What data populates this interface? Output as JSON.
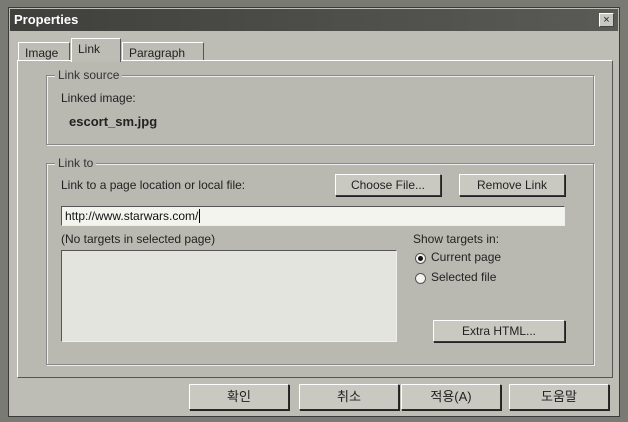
{
  "window": {
    "title": "Properties",
    "close_glyph": "×"
  },
  "tabs": [
    {
      "label": "Image",
      "selected": false
    },
    {
      "label": "Link",
      "selected": true
    },
    {
      "label": "Paragraph",
      "selected": false
    }
  ],
  "link_source": {
    "legend": "Link source",
    "linked_image_label": "Linked image:",
    "linked_image_value": "escort_sm.jpg"
  },
  "link_to": {
    "legend": "Link to",
    "field_label": "Link to a page location or local file:",
    "choose_file_label": "Choose File...",
    "remove_link_label": "Remove Link",
    "url_value": "http://www.starwars.com/",
    "targets_label": "(No targets in selected page)",
    "show_targets_label": "Show targets in:",
    "options": [
      {
        "label": "Current page",
        "selected": true
      },
      {
        "label": "Selected file",
        "selected": false
      }
    ],
    "extra_html_label": "Extra HTML..."
  },
  "footer": {
    "ok_label": "확인",
    "cancel_label": "취소",
    "apply_label": "적용(A)",
    "help_label": "도움말"
  }
}
